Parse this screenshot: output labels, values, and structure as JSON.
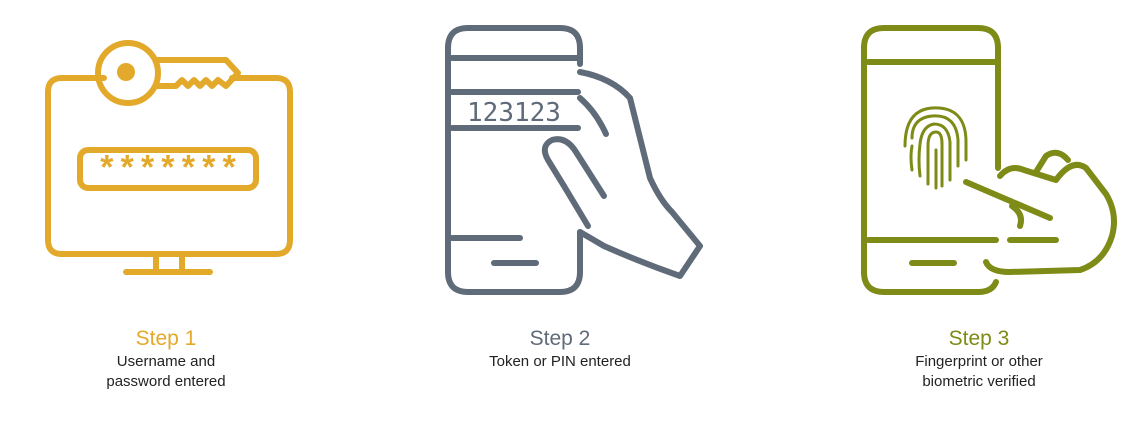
{
  "colors": {
    "step1": "#E3A92A",
    "step2": "#5F6B79",
    "step3": "#7E8B16",
    "text": "#222222"
  },
  "steps": [
    {
      "title": "Step 1",
      "desc_line1": "Username and",
      "desc_line2": "password entered",
      "icon": "monitor-key-password-icon",
      "password_mask": "*******"
    },
    {
      "title": "Step 2",
      "desc_line1": "Token or PIN entered",
      "desc_line2": "",
      "icon": "phone-token-hand-icon",
      "token_code": "123123"
    },
    {
      "title": "Step 3",
      "desc_line1": "Fingerprint or other",
      "desc_line2": "biometric verified",
      "icon": "phone-fingerprint-hand-icon"
    }
  ]
}
